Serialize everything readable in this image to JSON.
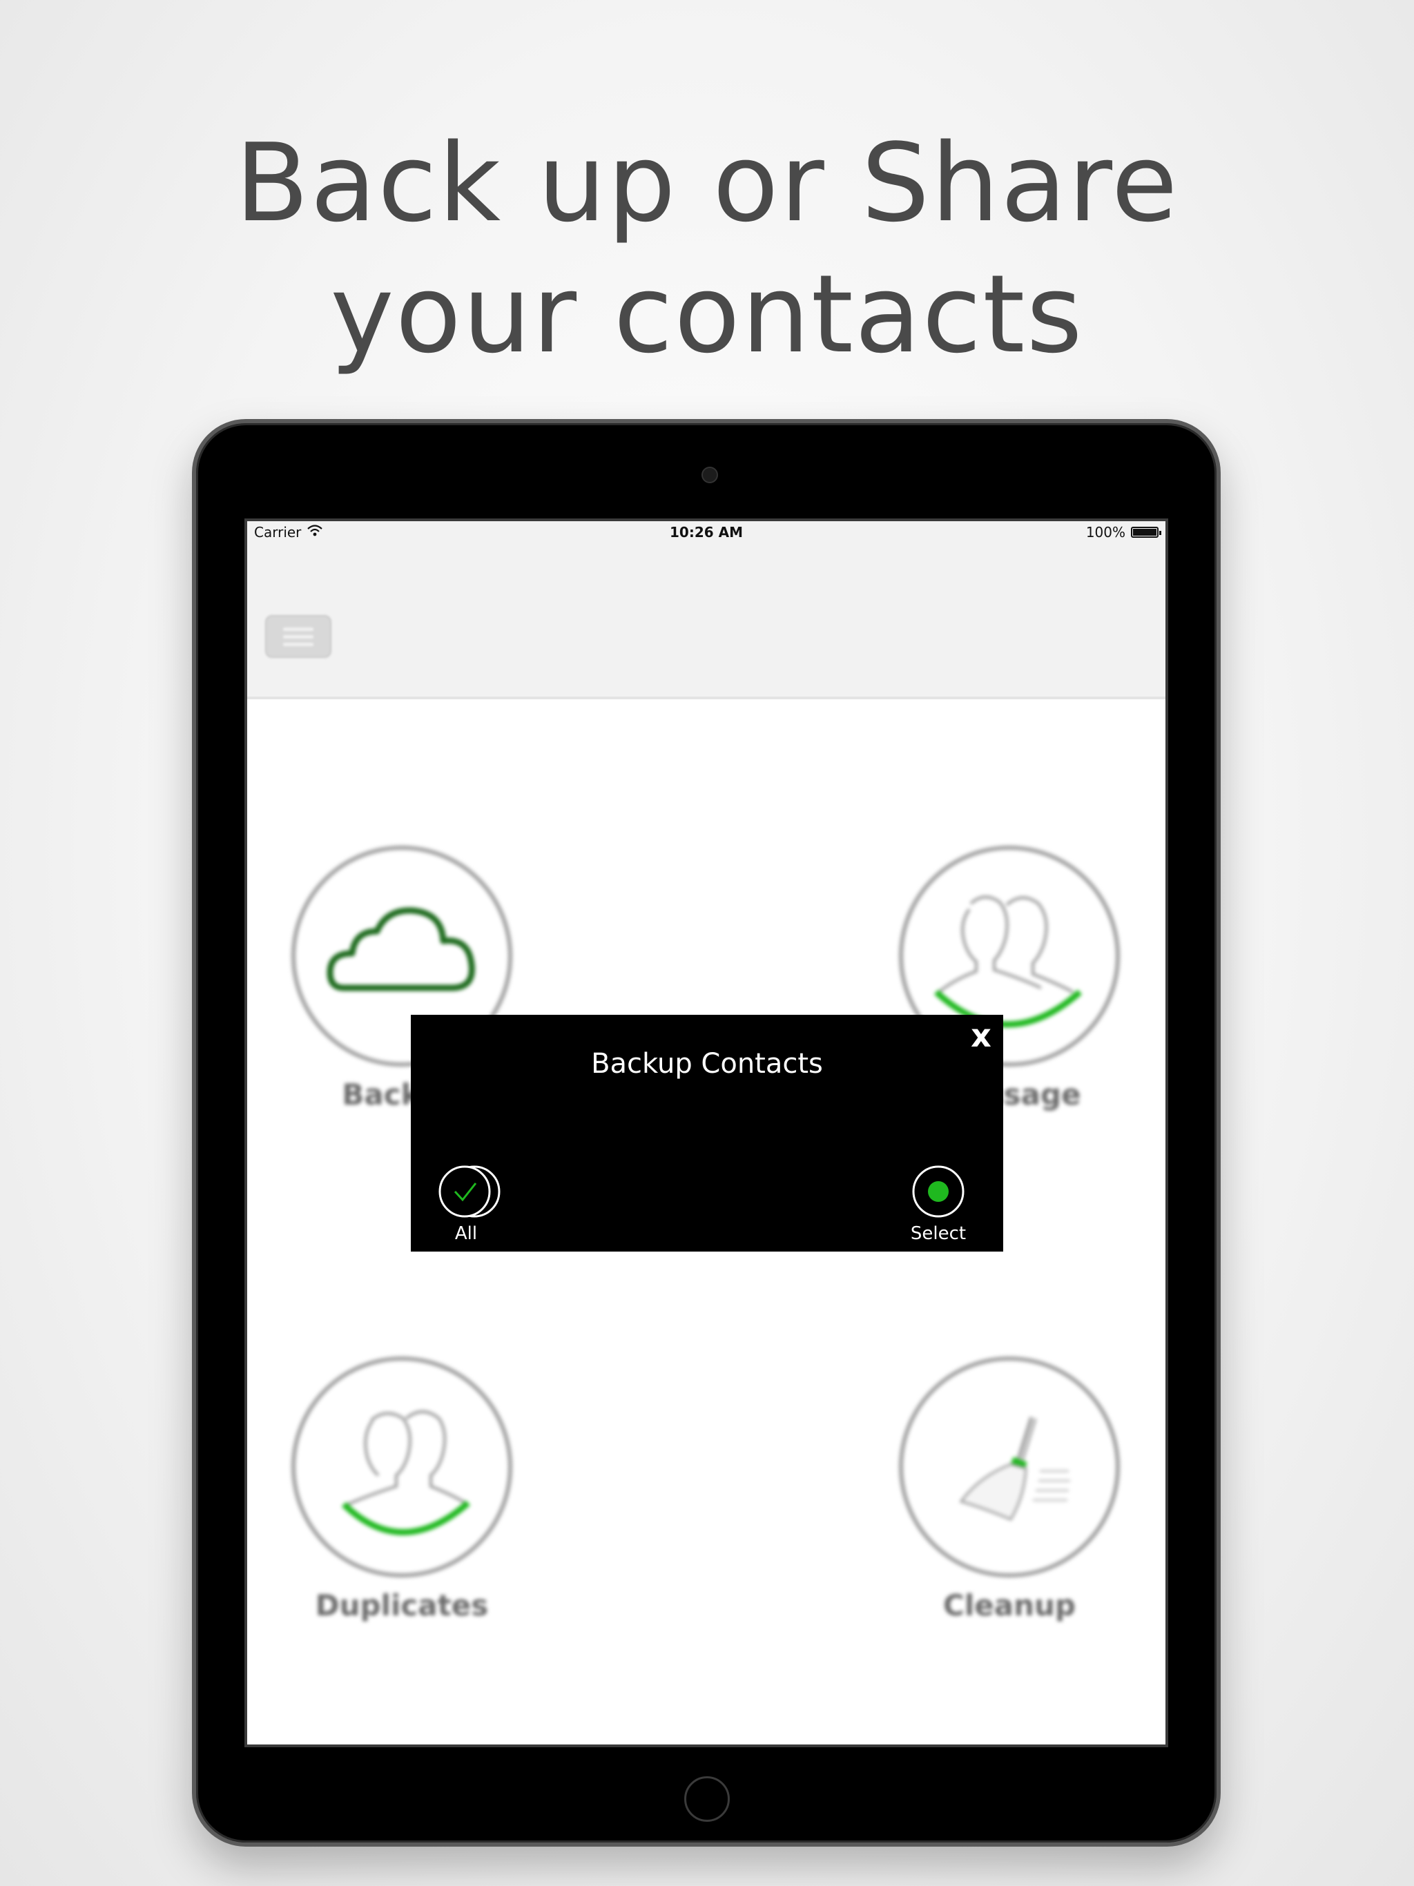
{
  "headline": {
    "line1": "Back up or Share",
    "line2": "your contacts"
  },
  "status_bar": {
    "carrier": "Carrier",
    "time": "10:26 AM",
    "battery": "100%"
  },
  "nav": {
    "menu_icon": "hamburger-menu-icon"
  },
  "tiles": [
    {
      "label": "Backup",
      "icon": "cloud-icon"
    },
    {
      "label": "Message",
      "icon": "group-contacts-icon"
    },
    {
      "label": "Duplicates",
      "icon": "duplicate-contacts-icon"
    },
    {
      "label": "Cleanup",
      "icon": "broom-icon"
    }
  ],
  "modal": {
    "title": "Backup Contacts",
    "close_label": "x",
    "options": [
      {
        "label": "All",
        "icon": "check-all-icon"
      },
      {
        "label": "Select",
        "icon": "radio-selected-icon"
      }
    ]
  },
  "colors": {
    "accent_green": "#1fb81f",
    "cloud_green": "#1e6b1e",
    "headline_gray": "#4a4a4a"
  }
}
